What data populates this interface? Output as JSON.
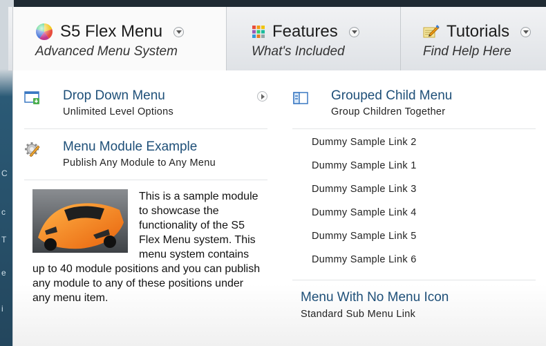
{
  "tabs": [
    {
      "title": "S5 Flex Menu",
      "subtitle": "Advanced Menu System",
      "icon": "color-orb-icon"
    },
    {
      "title": "Features",
      "subtitle": "What's Included",
      "icon": "color-grid-icon"
    },
    {
      "title": "Tutorials",
      "subtitle": "Find Help Here",
      "icon": "pencil-note-icon"
    }
  ],
  "left_column": {
    "items": [
      {
        "title": "Drop Down Menu",
        "subtitle": "Unlimited Level Options",
        "icon": "window-download-icon"
      },
      {
        "title": "Menu Module Example",
        "subtitle": "Publish Any Module to Any Menu",
        "icon": "gear-pencil-icon"
      }
    ],
    "module": {
      "text": "This is a sample module to showcase the functionality of the S5 Flex Menu system. This menu system contains up to 40 module positions and you can publish any module to any of these positions under any menu item.",
      "image": "orange-sports-car"
    }
  },
  "right_column": {
    "group": {
      "title": "Grouped Child Menu",
      "subtitle": "Group Children Together",
      "icon": "grouped-window-icon"
    },
    "links": [
      "Dummy Sample Link 2",
      "Dummy Sample Link 1",
      "Dummy Sample Link 3",
      "Dummy Sample Link 4",
      "Dummy Sample Link 5",
      "Dummy Sample Link 6"
    ],
    "plain_item": {
      "title": "Menu With No Menu Icon",
      "subtitle": "Standard Sub Menu Link"
    }
  },
  "colors": {
    "link_blue": "#1e4f78",
    "tab_bg": "#e3e6ea",
    "panel_bg": "#ffffff"
  }
}
